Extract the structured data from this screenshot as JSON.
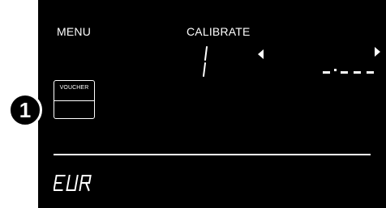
{
  "display": {
    "menu_label": "MENU",
    "calibrate_label": "CALIBRATE",
    "voucher_label": "VOUCHER",
    "currency_code": "EUR",
    "segment_digit": "1"
  },
  "callout": {
    "number": "1"
  },
  "colors": {
    "lcd_background": "#000000",
    "lcd_foreground": "#ffffff",
    "page_background": "#ffffff"
  },
  "icons": {
    "left_arrow": "triangle-left-icon",
    "right_arrow": "triangle-right-icon"
  }
}
